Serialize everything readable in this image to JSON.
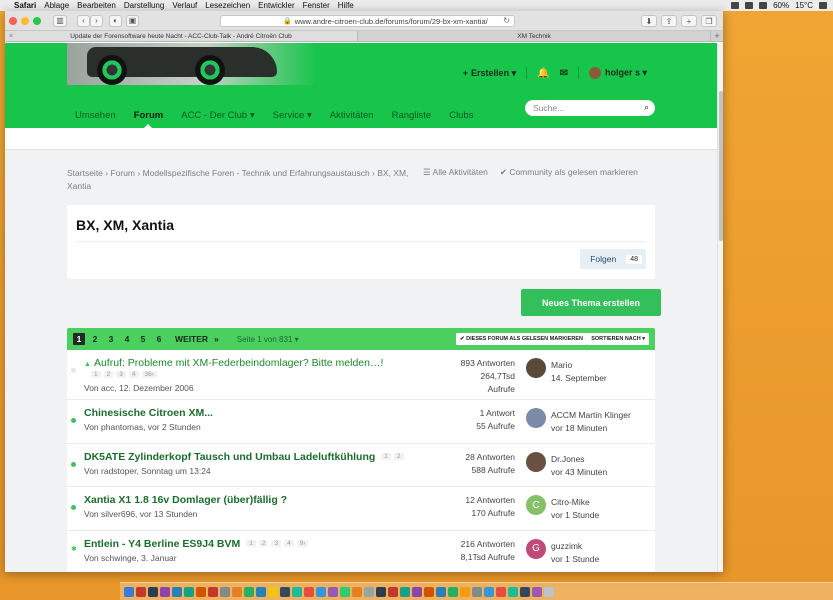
{
  "menubar": {
    "app": "Safari",
    "items": [
      "Ablage",
      "Bearbeiten",
      "Darstellung",
      "Verlauf",
      "Lesezeichen",
      "Entwickler",
      "Fenster",
      "Hilfe"
    ],
    "battery": "60%",
    "temp": "15°C"
  },
  "browser": {
    "url": "www.andre-citroen-club.de/forums/forum/29-bx-xm-xantia/",
    "tabs": [
      {
        "label": "Update der Forensoftware heute Nacht - ACC-Club-Talk - André Citroën Club"
      },
      {
        "label": "XM Technik"
      }
    ]
  },
  "header": {
    "create_label": "Erstellen",
    "username": "holger s",
    "search_placeholder": "Suche..."
  },
  "nav": {
    "items": [
      {
        "label": "Umsehen"
      },
      {
        "label": "Forum"
      },
      {
        "label": "ACC - Der Club"
      },
      {
        "label": "Service"
      },
      {
        "label": "Aktivitäten"
      },
      {
        "label": "Rangliste"
      },
      {
        "label": "Clubs"
      }
    ]
  },
  "breadcrumb": {
    "text": "Startseite › Forum › Modellspezifische Foren - Technik und Erfahrungsaustausch › BX, XM, Xantia",
    "all_activity": "Alle Aktivitäten",
    "mark_read": "Community als gelesen markieren"
  },
  "forum": {
    "title": "BX, XM, Xantia",
    "follow_label": "Folgen",
    "follow_count": "48",
    "new_topic": "Neues Thema erstellen"
  },
  "pagination": {
    "pages": [
      "1",
      "2",
      "3",
      "4",
      "5",
      "6"
    ],
    "next": "WEITER",
    "last": "»",
    "page_of": "Seite 1 von 831 ▾",
    "mark_read": "✔ DIESES FORUM ALS GELESEN MARKIEREN",
    "sort": "SORTIEREN NACH ▾"
  },
  "topics": [
    {
      "title": "Aufruf: Probleme mit XM-Federbeindomlager? Bitte melden…!",
      "pages": [
        "1",
        "2",
        "3",
        "4",
        "36›"
      ],
      "meta": "Von acc, 12. Dezember 2006",
      "stats_line1": "893 Antworten",
      "stats_line2": "264,7Tsd",
      "stats_line3": "Aufrufe",
      "last_user": "Mario",
      "last_date": "14. September",
      "avatar_color": "#5a4a3a"
    },
    {
      "title": "Chinesische Citroen XM...",
      "meta": "Von phantomas, vor 2 Stunden",
      "stats_line1": "1 Antwort",
      "stats_line2": "55 Aufrufe",
      "last_user": "ACCM Martin Klinger",
      "last_date": "vor 18 Minuten",
      "avatar_color": "#7a8aa8"
    },
    {
      "title": "DK5ATE Zylinderkopf Tausch und Umbau Ladeluftkühlung",
      "pages": [
        "1",
        "2"
      ],
      "meta": "Von radstoper, Sonntag um 13:24",
      "stats_line1": "28 Antworten",
      "stats_line2": "588 Aufrufe",
      "last_user": "Dr.Jones",
      "last_date": "vor 43 Minuten",
      "avatar_color": "#6a5040"
    },
    {
      "title": "Xantia X1 1.8 16v Domlager (über)fällig ?",
      "meta": "Von silver696, vor 13 Stunden",
      "stats_line1": "12 Antworten",
      "stats_line2": "170 Aufrufe",
      "last_user": "Citro-Mike",
      "last_date": "vor 1 Stunde",
      "avatar_letter": "C",
      "avatar_color": "#86c06a"
    },
    {
      "title": "Entlein - Y4 Berline ES9J4 BVM",
      "pages": [
        "1",
        "2",
        "3",
        "4",
        "9›"
      ],
      "meta": "Von schwinge, 3. Januar",
      "stats_line1": "216 Antworten",
      "stats_line2": "8,1Tsd Aufrufe",
      "last_user": "guzzimk",
      "last_date": "vor 1 Stunde",
      "avatar_letter": "G",
      "avatar_color": "#c04a7a"
    }
  ]
}
